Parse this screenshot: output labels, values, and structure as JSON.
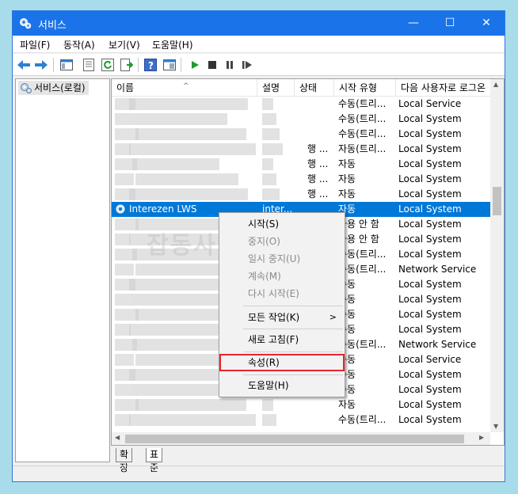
{
  "window": {
    "title": "서비스"
  },
  "titlebar": {
    "min": "—",
    "max": "☐",
    "close": "✕"
  },
  "menu": [
    "파일(F)",
    "동작(A)",
    "보기(V)",
    "도움말(H)"
  ],
  "tree": {
    "root": "서비스(로컬)"
  },
  "columns": [
    "이름",
    "설명",
    "상태",
    "시작 유형",
    "다음 사용자로 로그온"
  ],
  "rows": [
    {
      "start": "수동(트리...",
      "logon": "Local Service"
    },
    {
      "start": "수동(트리...",
      "logon": "Local System"
    },
    {
      "start": "수동(트리...",
      "logon": "Local System"
    },
    {
      "status": "행 ...",
      "start": "자동(트리...",
      "logon": "Local System"
    },
    {
      "status": "행 ...",
      "start": "자동",
      "logon": "Local System"
    },
    {
      "status": "행 ...",
      "start": "자동",
      "logon": "Local System"
    },
    {
      "status": "행 ...",
      "start": "자동",
      "logon": "Local System"
    },
    {
      "name": "Interezen LWS",
      "desc": "inter...",
      "start": "자동",
      "logon": "Local System",
      "selected": true
    },
    {
      "start": "사용 안 함",
      "logon": "Local System"
    },
    {
      "start": "사용 안 함",
      "logon": "Local System"
    },
    {
      "start": "수동(트리...",
      "logon": "Local System"
    },
    {
      "start": "수동(트리...",
      "logon": "Network Service"
    },
    {
      "start": "수동",
      "logon": "Local System"
    },
    {
      "start": "수동",
      "logon": "Local System"
    },
    {
      "start": "수동",
      "logon": "Local System"
    },
    {
      "start": "수동",
      "logon": "Local System"
    },
    {
      "start": "수동(트리...",
      "logon": "Network Service"
    },
    {
      "start": "수동",
      "logon": "Local Service"
    },
    {
      "start": "수동",
      "logon": "Local System"
    },
    {
      "start": "수동",
      "logon": "Local System"
    },
    {
      "start": "자동",
      "logon": "Local System"
    },
    {
      "start": "수동(트리...",
      "logon": "Local System"
    }
  ],
  "context_menu": {
    "start": "시작(S)",
    "stop": "중지(O)",
    "pause": "일시 중지(U)",
    "resume": "계속(M)",
    "restart": "다시 시작(E)",
    "all_tasks": "모든 작업(K)",
    "refresh": "새로 고침(F)",
    "properties": "속성(R)",
    "help": "도움말(H)"
  },
  "tabs": {
    "extended": "확장",
    "standard": "표준"
  },
  "watermark": "잡동사니 블로그",
  "colors": {
    "titlebar": "#1a73e8",
    "selection": "#0078d7",
    "highlight_box": "#e8262b"
  }
}
